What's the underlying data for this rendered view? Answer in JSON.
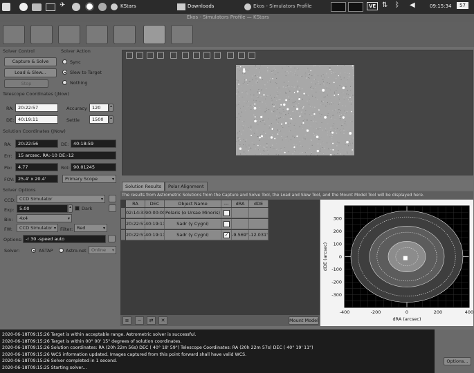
{
  "taskbar": {
    "kstars_label": "KStars",
    "downloads_label": "Downloads",
    "active_window": "Ekos - Simulators Profile",
    "clock": "09:15:34",
    "cpu": "57",
    "ve_label": "VE"
  },
  "window": {
    "title": "Ekos - Simulators Profile — KStars"
  },
  "solver_control": {
    "heading": "Solver Control",
    "capture_solve": "Capture & Solve",
    "load_slew": "Load & Slew...",
    "stop": "Stop"
  },
  "solver_action": {
    "heading": "Solver Action",
    "options": [
      "Sync",
      "Slew to Target",
      "Nothing"
    ],
    "selected": "Slew to Target"
  },
  "telescope_coords": {
    "heading": "Telescope Coordinates (JNow)",
    "ra_label": "RA:",
    "ra": "20:22:57",
    "de_label": "DE:",
    "de": "40:19:11",
    "accuracy_label": "Accuracy",
    "accuracy": "120",
    "settle_label": "Settle",
    "settle": "1500"
  },
  "solution_coords": {
    "heading": "Solution Coordinates (JNow)",
    "ra_label": "RA:",
    "ra": "20:22:56",
    "de_label": "DE:",
    "de": "40:18:59",
    "err_label": "Err:",
    "err": "15 arcsec. RA:-10 DE:-12",
    "pix_label": "Pix:",
    "pix": "4.77",
    "rot_label": "Rot:",
    "rot": "90.01245",
    "fov_label": "FOV:",
    "fov": "25.4' x 20.4'",
    "scope": "Primary Scope"
  },
  "solver_options": {
    "heading": "Solver Options",
    "ccd_label": "CCD:",
    "ccd": "CCD Simulator",
    "exp_label": "Exp:",
    "exp": "5.00",
    "dark_label": "Dark",
    "bin_label": "Bin:",
    "bin": "4x4",
    "fw_label": "FW:",
    "fw": "CCD Simulator",
    "filter_label": "Filter:",
    "filter": "Red",
    "options_label": "Options:",
    "options": "-r 30 -speed auto",
    "solver_label": "Solver:",
    "solver_a": "ASTAP",
    "solver_b": "Astro.net",
    "online": "Online"
  },
  "results": {
    "tab1": "Solution Results",
    "tab2": "Polar Alignment",
    "info": "The results from Astrometric Solutions from the Capture and Solve Tool, the Load and Slew Tool, and the Mount Model Tool will be displayed here.",
    "headers": [
      "RA",
      "DEC",
      "Object Name",
      "---",
      "dRA",
      "dDE"
    ],
    "rows": [
      [
        "02:14:33",
        "90:00:00",
        "Polaris (α Ursae Minoris)",
        "",
        "",
        ""
      ],
      [
        "20:22:57",
        "40:19:11",
        "Sadr (γ Cygni)",
        "",
        "",
        ""
      ],
      [
        "20:22:57",
        "40:19:11",
        "Sadr (γ Cygni)",
        "",
        "-9.569\"",
        "-12.031\""
      ]
    ],
    "mount_model": "Mount Model"
  },
  "chart_data": {
    "type": "scatter",
    "xlabel": "dRA (arcsec)",
    "ylabel": "dDE (arcsec)",
    "xlim": [
      -400,
      400
    ],
    "ylim": [
      -400,
      400
    ],
    "xticks": [
      -400,
      -200,
      0,
      200,
      400
    ],
    "yticks": [
      -300,
      -200,
      -100,
      0,
      100,
      200,
      300
    ],
    "points": [
      {
        "x": -9.569,
        "y": -12.031
      }
    ],
    "accuracy_radius": 120,
    "grid": true,
    "background": "#000000"
  },
  "log": {
    "lines": [
      "2020-06-18T09:15:26 Target is within acceptable range. Astrometric solver is successful.",
      "2020-06-18T09:15:26 Target is within  00° 00' 15\" degrees of solution coordinates.",
      "2020-06-18T09:15:26 Solution coordinates: RA (20h 22m 56s) DEC ( 40° 18' 59\") Telescope Coordinates: RA (20h 22m 57s) DEC ( 40° 19' 11\")",
      "2020-06-18T09:15:26 WCS information updated. Images captured from this point forward shall have valid WCS.",
      "2020-06-18T09:15:26 Solver completed in 1 second.",
      "2020-06-18T09:15:25 Starting solver..."
    ],
    "options_button": "Options..."
  }
}
